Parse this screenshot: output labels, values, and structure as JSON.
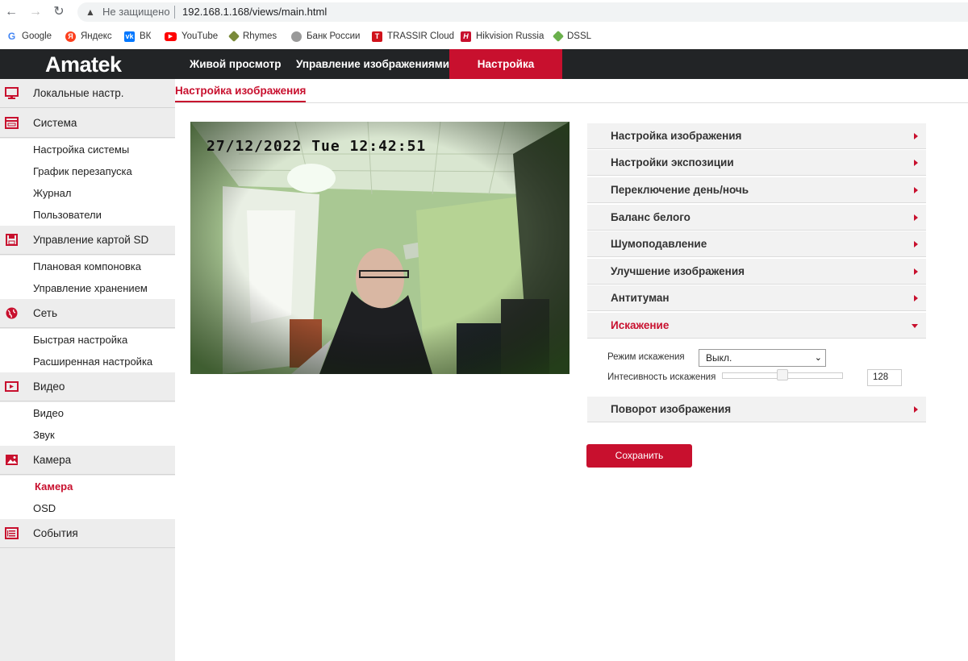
{
  "browser": {
    "insecure_label": "Не защищено",
    "url": "192.168.1.168/views/main.html",
    "bookmarks": [
      {
        "label": "Google"
      },
      {
        "label": "Яндекс"
      },
      {
        "label": "ВК"
      },
      {
        "label": "YouTube"
      },
      {
        "label": "Rhymes"
      },
      {
        "label": "Банк России"
      },
      {
        "label": "TRASSIR Cloud"
      },
      {
        "label": "Hikvision Russia"
      },
      {
        "label": "DSSL"
      }
    ]
  },
  "header": {
    "logo": "Amatek",
    "nav": [
      "Живой просмотр",
      "Управление изображениями",
      "Настройка"
    ]
  },
  "sidebar": {
    "local": "Локальные настр.",
    "system": "Система",
    "system_items": [
      "Настройка системы",
      "График перезапуска",
      "Журнал",
      "Пользователи"
    ],
    "sd": "Управление картой SD",
    "sd_items": [
      "Плановая компоновка",
      "Управление хранением"
    ],
    "network": "Сеть",
    "network_items": [
      "Быстрая настройка",
      "Расширенная настройка"
    ],
    "video": "Видео",
    "video_items": [
      "Видео",
      "Звук"
    ],
    "camera": "Камера",
    "camera_items": [
      "Камера",
      "OSD"
    ],
    "events": "События"
  },
  "main": {
    "tab": "Настройка изображения",
    "video_timestamp": "27/12/2022 Tue 12:42:51",
    "sections": [
      "Настройка изображения",
      "Настройки экспозиции",
      "Переключение день/ночь",
      "Баланс белого",
      "Шумоподавление",
      "Улучшение изображения",
      "Антитуман",
      "Искажение",
      "Поворот изображения"
    ],
    "distortion": {
      "mode_label": "Режим искажения",
      "mode_value": "Выкл.",
      "intensity_label": "Интесивность искажения",
      "intensity_value": "128",
      "intensity_level": 0.5
    },
    "save_label": "Сохранить"
  },
  "colors": {
    "accent": "#c8102e",
    "header_bg": "#222426",
    "sidebar_bg": "#ededed"
  }
}
